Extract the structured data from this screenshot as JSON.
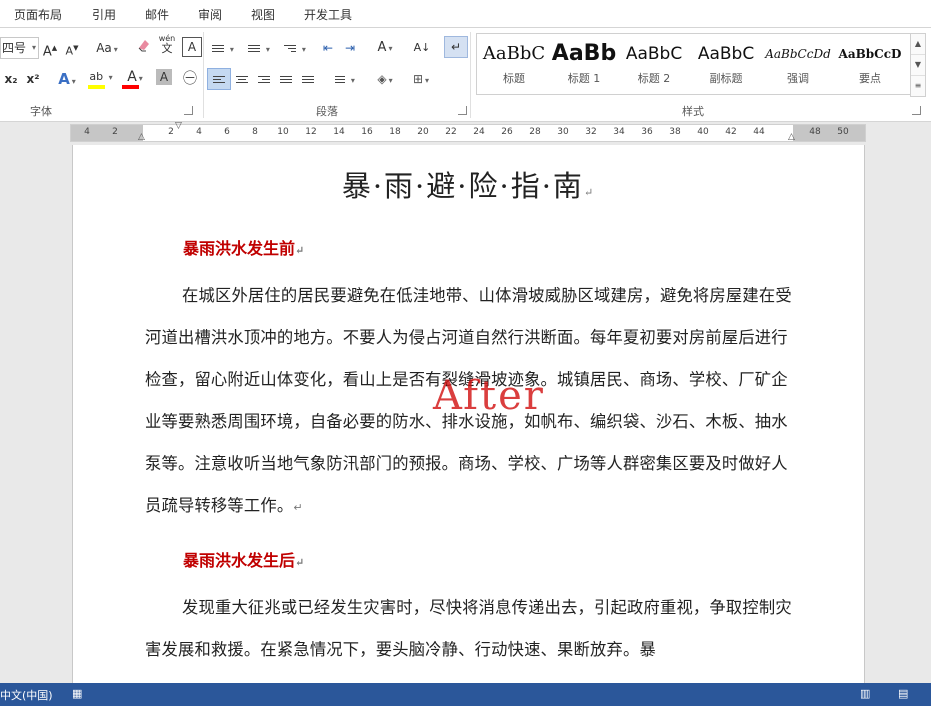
{
  "menu": {
    "tabs": [
      "页面布局",
      "引用",
      "邮件",
      "审阅",
      "视图",
      "开发工具"
    ]
  },
  "ribbon": {
    "font": {
      "size_value": "四号",
      "grow_label": "A",
      "shrink_label": "A",
      "case_label": "Aa",
      "subscript_label": "x₂",
      "superscript_label": "x²",
      "effects_label": "A",
      "highlight_label": "ab",
      "font_color_label": "A",
      "shading_label": "A",
      "group_label": "字体",
      "phonetic_label": "wén"
    },
    "paragraph": {
      "group_label": "段落"
    },
    "styles": {
      "group_label": "样式",
      "items": [
        {
          "preview": "AaBbC",
          "label": "标题"
        },
        {
          "preview": "AaBb",
          "label": "标题 1"
        },
        {
          "preview": "AaBbC",
          "label": "标题 2"
        },
        {
          "preview": "AaBbC",
          "label": "副标题"
        },
        {
          "preview": "AaBbCcDd",
          "label": "强调"
        },
        {
          "preview": "AaBbCcD",
          "label": "要点"
        }
      ]
    },
    "colors": {
      "highlight": "#ffff00",
      "font_color": "#ff0000",
      "accent": "#2b579a"
    }
  },
  "ruler": {
    "numbers": [
      "4",
      "2",
      "2",
      "4",
      "6",
      "8",
      "10",
      "12",
      "14",
      "16",
      "18",
      "20",
      "22",
      "24",
      "26",
      "28",
      "30",
      "32",
      "34",
      "36",
      "38",
      "40",
      "42",
      "44",
      "48",
      "50"
    ]
  },
  "document": {
    "title": "暴·雨·避·险·指·南",
    "watermark": "After",
    "para_mark": "↵",
    "sections": [
      {
        "heading": "暴雨洪水发生前",
        "body": "在城区外居住的居民要避免在低洼地带、山体滑坡威胁区域建房，避免将房屋建在受河道出槽洪水顶冲的地方。不要人为侵占河道自然行洪断面。每年夏初要对房前屋后进行检查，留心附近山体变化，看山上是否有裂缝滑坡迹象。城镇居民、商场、学校、厂矿企业等要熟悉周围环境，自备必要的防水、排水设施，如帆布、编织袋、沙石、木板、抽水泵等。注意收听当地气象防汛部门的预报。商场、学校、广场等人群密集区要及时做好人员疏导转移等工作。"
      },
      {
        "heading": "暴雨洪水发生后",
        "body": "发现重大征兆或已经发生灾害时，尽快将消息传递出去，引起政府重视，争取控制灾害发展和救援。在紧急情况下，要头脑冷静、行动快速、果断放弃。暴"
      }
    ]
  },
  "statusbar": {
    "language": "中文(中国)"
  }
}
